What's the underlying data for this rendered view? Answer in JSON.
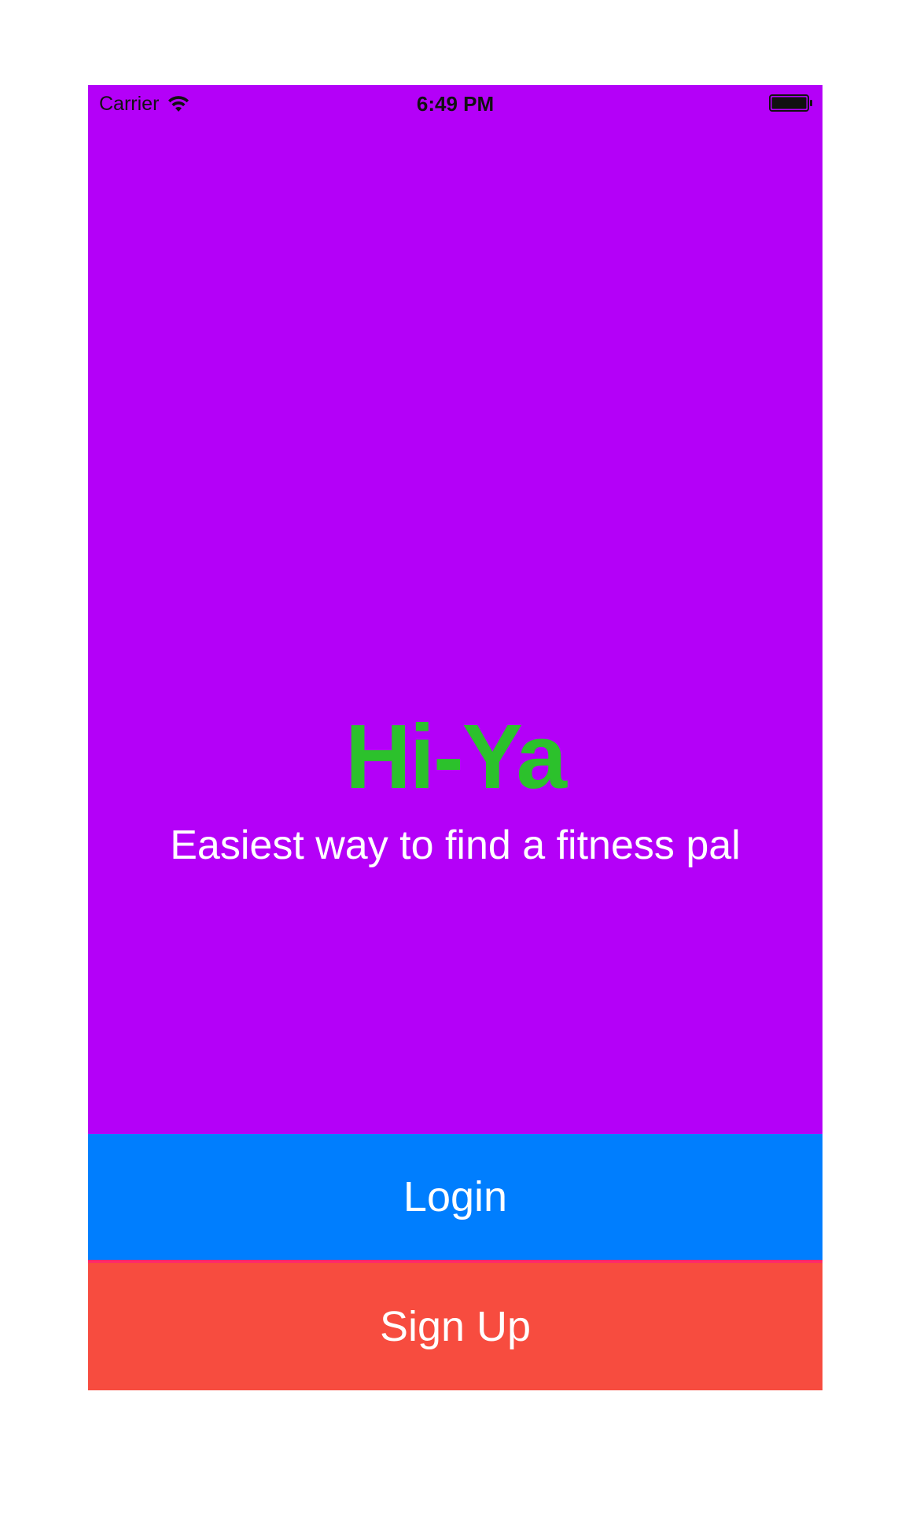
{
  "status_bar": {
    "carrier": "Carrier",
    "time": "6:49 PM",
    "icons": [
      "wifi-icon",
      "battery-icon"
    ]
  },
  "hero": {
    "title": "Hi-Ya",
    "tagline": "Easiest way to find a fitness pal"
  },
  "actions": {
    "login_label": "Login",
    "signup_label": "Sign Up"
  },
  "colors": {
    "background": "#b400f8",
    "title": "#2cc12c",
    "login": "#007efe",
    "signup": "#f74c3f",
    "divider": "#ff2a6a"
  }
}
